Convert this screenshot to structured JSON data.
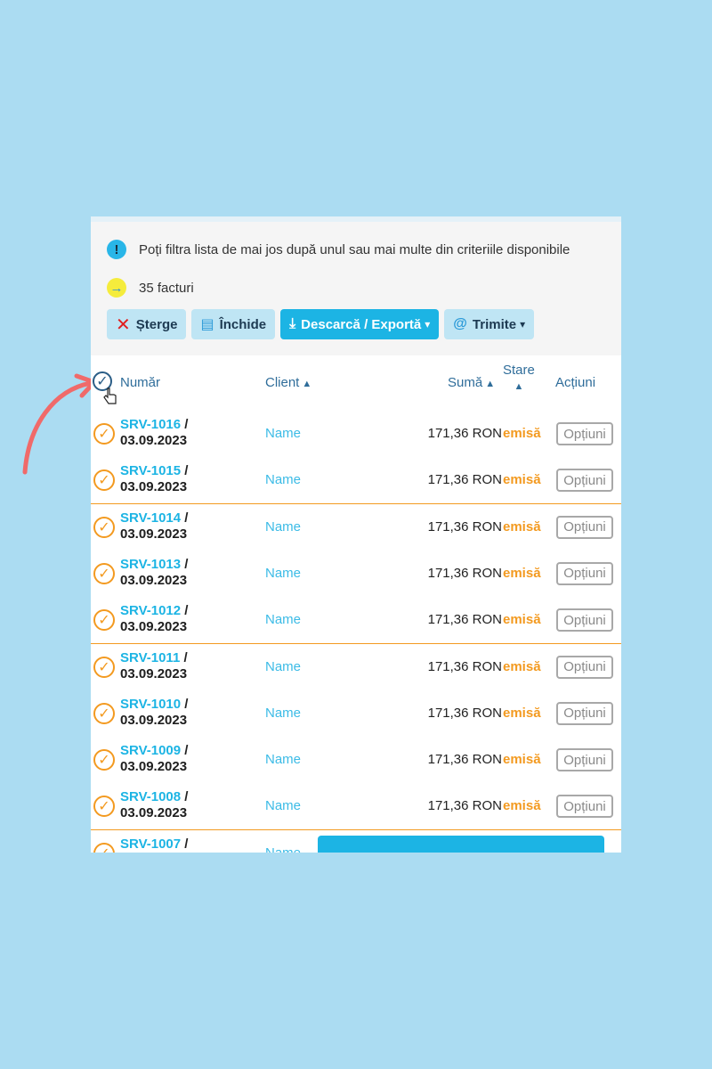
{
  "info": {
    "hint": "Poți filtra lista de mai jos după unul sau mai multe din criteriile disponibile",
    "count": "35 facturi"
  },
  "toolbar": {
    "delete_label": "Șterge",
    "close_label": "Închide",
    "export_label": "Descarcă / Exportă",
    "send_label": "Trimite"
  },
  "table": {
    "headers": {
      "number": "Număr",
      "client": "Client",
      "sum": "Sumă",
      "state": "Stare",
      "actions": "Acțiuni"
    },
    "rows": [
      {
        "code": "SRV-1016",
        "date": "03.09.2023",
        "client": "Name",
        "sum": "171,36 RON",
        "state": "emisă",
        "action": "Opțiuni"
      },
      {
        "code": "SRV-1015",
        "date": "03.09.2023",
        "client": "Name",
        "sum": "171,36 RON",
        "state": "emisă",
        "action": "Opțiuni"
      },
      {
        "code": "SRV-1014",
        "date": "03.09.2023",
        "client": "Name",
        "sum": "171,36 RON",
        "state": "emisă",
        "action": "Opțiuni"
      },
      {
        "code": "SRV-1013",
        "date": "03.09.2023",
        "client": "Name",
        "sum": "171,36 RON",
        "state": "emisă",
        "action": "Opțiuni"
      },
      {
        "code": "SRV-1012",
        "date": "03.09.2023",
        "client": "Name",
        "sum": "171,36 RON",
        "state": "emisă",
        "action": "Opțiuni"
      },
      {
        "code": "SRV-1011",
        "date": "03.09.2023",
        "client": "Name",
        "sum": "171,36 RON",
        "state": "emisă",
        "action": "Opțiuni"
      },
      {
        "code": "SRV-1010",
        "date": "03.09.2023",
        "client": "Name",
        "sum": "171,36 RON",
        "state": "emisă",
        "action": "Opțiuni"
      },
      {
        "code": "SRV-1009",
        "date": "03.09.2023",
        "client": "Name",
        "sum": "171,36 RON",
        "state": "emisă",
        "action": "Opțiuni"
      },
      {
        "code": "SRV-1008",
        "date": "03.09.2023",
        "client": "Name",
        "sum": "171,36 RON",
        "state": "emisă",
        "action": "Opțiuni"
      },
      {
        "code": "SRV-1007",
        "date": "",
        "client": "Name",
        "sum": "",
        "state": "",
        "action": ""
      }
    ]
  },
  "colors": {
    "background": "#abdcf2",
    "accent": "#1cb4e4",
    "status": "#f39a20",
    "annotation_arrow": "#f06a6a"
  },
  "icons": [
    "info-icon",
    "arrow-right-icon",
    "close-x-icon",
    "archive-icon",
    "download-icon",
    "at-icon",
    "check-circle-icon",
    "hand-cursor-icon"
  ]
}
